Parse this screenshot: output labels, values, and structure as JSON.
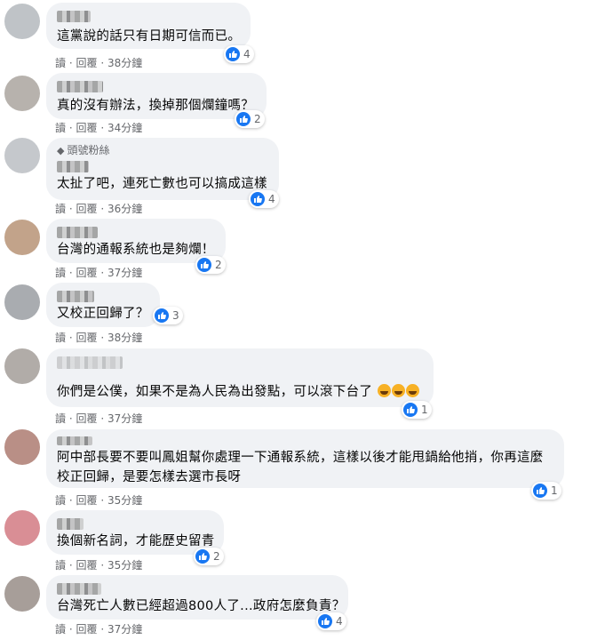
{
  "action_labels": {
    "reply": "讀",
    "respond": "回覆",
    "sep": "·"
  },
  "colors": {
    "like_blue": "#1877f2",
    "bubble": "#f0f2f5",
    "meta": "#65676b"
  },
  "comments": [
    {
      "badge": "",
      "text": [
        "這黨說的話只有日期可信而已。"
      ],
      "reactions": "4",
      "time": "38分鐘",
      "emoji_suffix": ""
    },
    {
      "badge": "",
      "text": [
        "真的沒有辦法，換掉那個爛鐘嗎？"
      ],
      "reactions": "2",
      "time": "34分鐘",
      "emoji_suffix": ""
    },
    {
      "badge": "頭號粉絲",
      "text": [
        "太扯了吧，連死亡數也可以搞成這樣"
      ],
      "reactions": "4",
      "time": "36分鐘",
      "emoji_suffix": ""
    },
    {
      "badge": "",
      "text": [
        "台灣的通報系統也是夠爛！"
      ],
      "reactions": "2",
      "time": "37分鐘",
      "emoji_suffix": ""
    },
    {
      "badge": "",
      "text": [
        "又校正回歸了？"
      ],
      "reactions": "3",
      "time": "38分鐘",
      "emoji_suffix": ""
    },
    {
      "badge": "",
      "text": [
        "你們是公僕，如果不是為人民為出發點，可以滾下台了"
      ],
      "reactions": "1",
      "time": "37分鐘",
      "emoji_suffix": "😤😤😤"
    },
    {
      "badge": "",
      "text": [
        "阿中部長要不要叫鳳姐幫你處理一下通報系統，這樣以後才能甩鍋給他捎，你再這麼",
        "校正回歸，是要怎樣去選市長呀"
      ],
      "reactions": "1",
      "time": "35分鐘",
      "emoji_suffix": ""
    },
    {
      "badge": "",
      "text": [
        "換個新名詞，才能歷史留青"
      ],
      "reactions": "2",
      "time": "35分鐘",
      "emoji_suffix": ""
    },
    {
      "badge": "",
      "text": [
        "台灣死亡人數已經超過800人了...政府怎麼負責？"
      ],
      "reactions": "4",
      "time": "37分鐘",
      "emoji_suffix": ""
    }
  ]
}
